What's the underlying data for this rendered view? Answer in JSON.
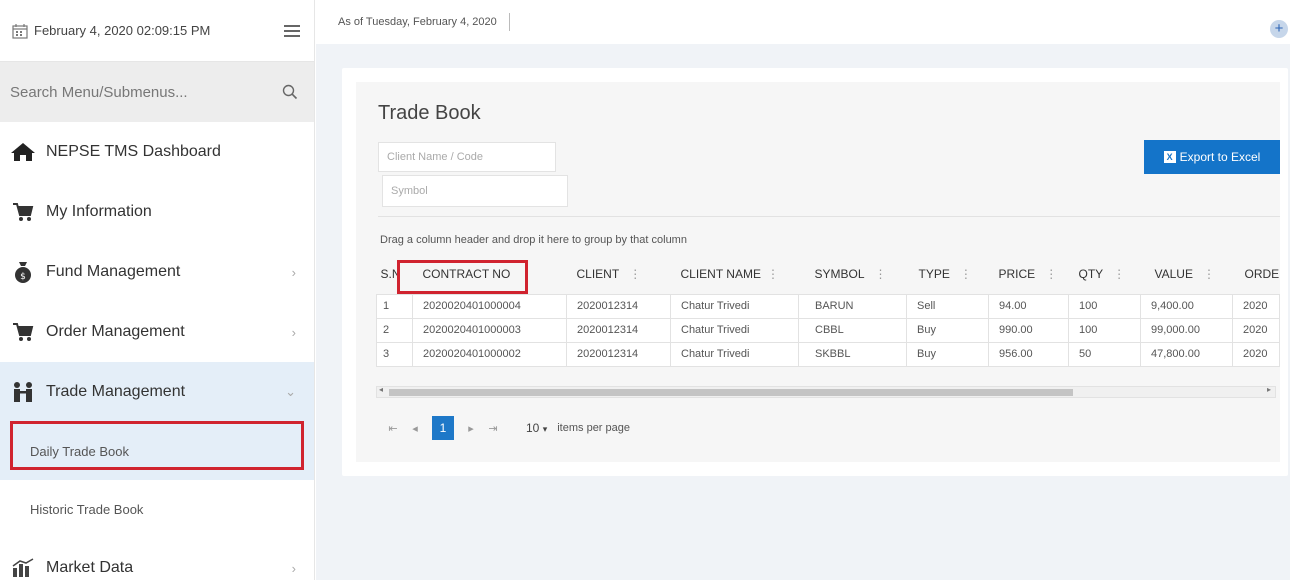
{
  "sidebar": {
    "datetime": "February 4, 2020 02:09:15 PM",
    "search_placeholder": "Search Menu/Submenus...",
    "items": [
      {
        "label": "NEPSE TMS Dashboard"
      },
      {
        "label": "My Information"
      },
      {
        "label": "Fund Management"
      },
      {
        "label": "Order Management"
      },
      {
        "label": "Trade Management"
      },
      {
        "label": "Market Data"
      }
    ],
    "subitems": [
      {
        "label": "Daily Trade Book"
      },
      {
        "label": "Historic Trade Book"
      }
    ]
  },
  "topbar": {
    "as_of": "As of Tuesday, February 4, 2020",
    "plus": "+"
  },
  "page": {
    "title": "Trade Book",
    "client_placeholder": "Client Name / Code",
    "symbol_placeholder": "Symbol",
    "export_label": "Export to Excel",
    "group_hint": "Drag a column header and drop it here to group by that column"
  },
  "table": {
    "headers": [
      "S.N",
      "CONTRACT NO",
      "CLIENT",
      "CLIENT NAME",
      "SYMBOL",
      "TYPE",
      "PRICE",
      "QTY",
      "VALUE",
      "ORDE"
    ],
    "rows": [
      [
        "1",
        "2020020401000004",
        "2020012314",
        "Chatur Trivedi",
        "BARUN",
        "Sell",
        "94.00",
        "100",
        "9,400.00",
        "2020"
      ],
      [
        "2",
        "2020020401000003",
        "2020012314",
        "Chatur Trivedi",
        "CBBL",
        "Buy",
        "990.00",
        "100",
        "99,000.00",
        "2020"
      ],
      [
        "3",
        "2020020401000002",
        "2020012314",
        "Chatur Trivedi",
        "SKBBL",
        "Buy",
        "956.00",
        "50",
        "47,800.00",
        "2020"
      ]
    ]
  },
  "pager": {
    "current": "1",
    "page_size": "10",
    "items_per_page": "items per page"
  }
}
